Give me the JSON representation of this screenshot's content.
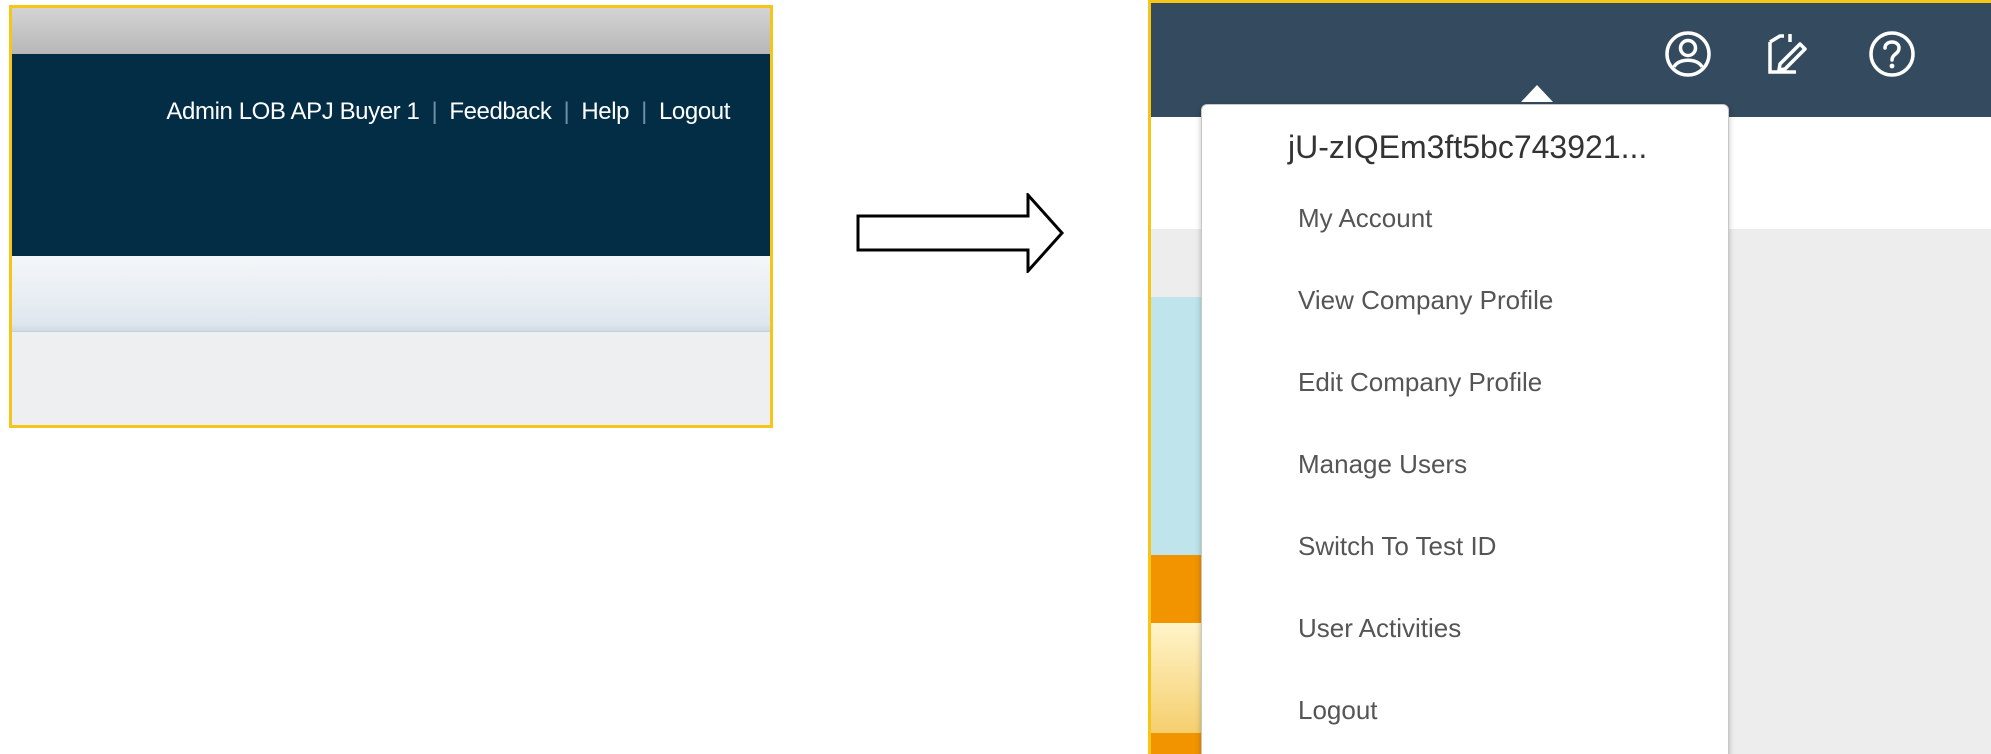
{
  "old_ui": {
    "user_name": "Admin LOB APJ Buyer 1",
    "separator": "|",
    "links": [
      "Feedback",
      "Help",
      "Logout"
    ]
  },
  "new_ui": {
    "header_icons": [
      "user-circle-icon",
      "edit-document-icon",
      "help-circle-icon"
    ],
    "menu": {
      "user_id": "jU-zIQEm3ft5bc743921...",
      "items": [
        "My Account",
        "View Company Profile",
        "Edit Company Profile",
        "Manage Users",
        "Switch To Test ID",
        "User Activities",
        "Logout"
      ]
    }
  },
  "colors": {
    "highlight_border": "#f5c518",
    "old_header": "#032d45",
    "new_header": "#344a5f"
  }
}
